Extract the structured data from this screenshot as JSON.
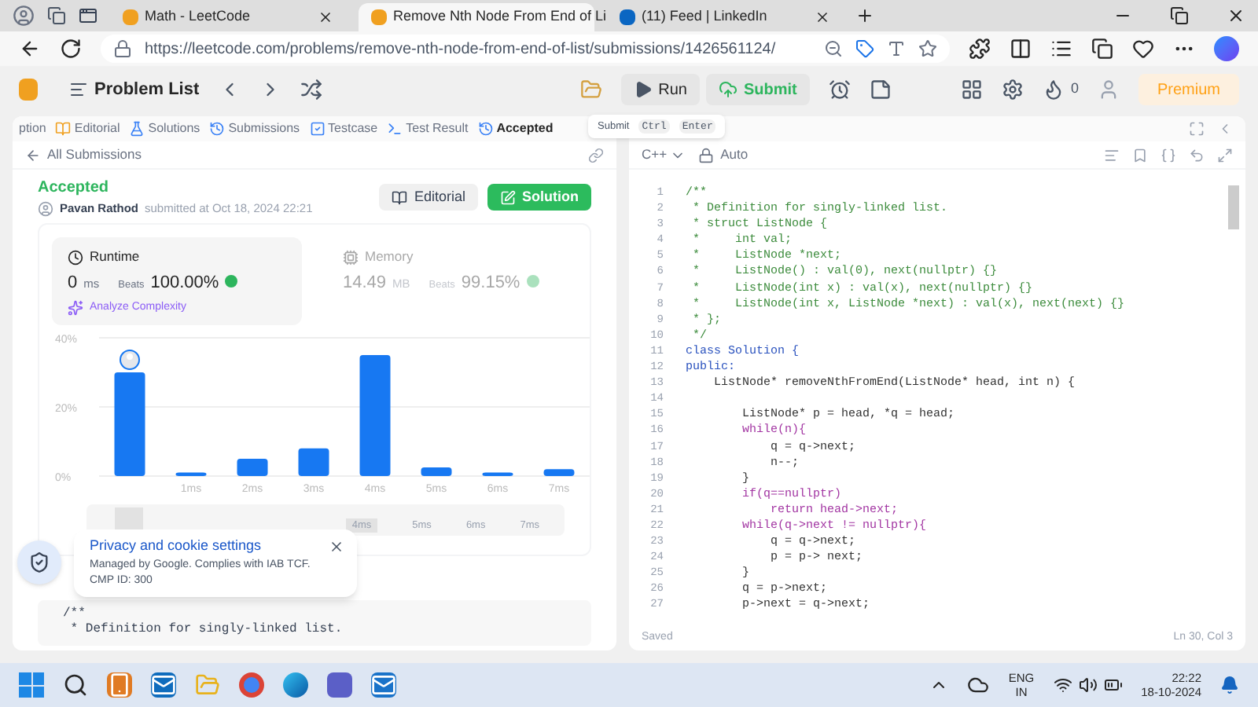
{
  "browser": {
    "tabs": [
      {
        "title": "Math - LeetCode",
        "selected": false
      },
      {
        "title": "Remove Nth Node From End of Li",
        "selected": true
      },
      {
        "title": "(11) Feed | LinkedIn",
        "selected": false
      }
    ],
    "url": "https://leetcode.com/problems/remove-nth-node-from-end-of-list/submissions/1426561124/"
  },
  "nav": {
    "title": "Problem List",
    "run": "Run",
    "submit": "Submit",
    "streak": "0",
    "premium": "Premium"
  },
  "tooltip": {
    "label": "Submit",
    "keys": [
      "Ctrl",
      "Enter"
    ]
  },
  "panel_tabs": [
    {
      "label": "ption",
      "selected": false
    },
    {
      "label": "Editorial",
      "selected": false
    },
    {
      "label": "Solutions",
      "selected": false
    },
    {
      "label": "Submissions",
      "selected": false
    },
    {
      "label": "Testcase",
      "selected": false
    },
    {
      "label": "Test Result",
      "selected": false
    },
    {
      "label": "Accepted",
      "selected": true
    }
  ],
  "submission": {
    "back": "All Submissions",
    "status": "Accepted",
    "author": "Pavan Rathod",
    "submitted": "submitted at Oct 18, 2024 22:21",
    "editorial": "Editorial",
    "solution": "Solution"
  },
  "stats": [
    {
      "label": "Runtime",
      "value": "0",
      "unit": "ms",
      "beats_label": "Beats",
      "beats": "100.00%",
      "analyze": "Analyze Complexity",
      "selected": true
    },
    {
      "label": "Memory",
      "value": "14.49",
      "unit": "MB",
      "beats_label": "Beats",
      "beats": "99.15%",
      "selected": false
    }
  ],
  "chart_data": {
    "type": "bar",
    "categories": [
      null,
      "1ms",
      "2ms",
      "3ms",
      "4ms",
      "5ms",
      "6ms",
      "7ms"
    ],
    "values": [
      30,
      1,
      5,
      8,
      35,
      2.5,
      1,
      2
    ],
    "ylim": [
      0,
      40
    ],
    "yticks": [
      {
        "value": 0,
        "label": "0%"
      },
      {
        "value": 20,
        "label": "20%"
      },
      {
        "value": 40,
        "label": "40%"
      }
    ]
  },
  "navigator": {
    "labels": [
      "4ms",
      "5ms",
      "6ms",
      "7ms"
    ]
  },
  "code_preview": [
    "/**",
    " * Definition for singly-linked list."
  ],
  "cookie_popup": {
    "title": "Privacy and cookie settings",
    "text": "Managed by Google. Complies with IAB TCF.",
    "cmp": "CMP ID: 300"
  },
  "editor": {
    "language": "C++",
    "mode": "Auto",
    "status": "Saved",
    "position": "Ln 30, Col 3",
    "lines": [
      {
        "n": "1",
        "text": "/**",
        "kind": "comment"
      },
      {
        "n": "2",
        "text": " * Definition for singly-linked list.",
        "kind": "comment"
      },
      {
        "n": "3",
        "text": " * struct ListNode {",
        "kind": "comment"
      },
      {
        "n": "4",
        "text": " *     int val;",
        "kind": "comment"
      },
      {
        "n": "5",
        "text": " *     ListNode *next;",
        "kind": "comment"
      },
      {
        "n": "6",
        "text": " *     ListNode() : val(0), next(nullptr) {}",
        "kind": "comment"
      },
      {
        "n": "7",
        "text": " *     ListNode(int x) : val(x), next(nullptr) {}",
        "kind": "comment"
      },
      {
        "n": "8",
        "text": " *     ListNode(int x, ListNode *next) : val(x), next(next) {}",
        "kind": "comment"
      },
      {
        "n": "9",
        "text": " * };",
        "kind": "comment"
      },
      {
        "n": "10",
        "text": " */",
        "kind": "comment"
      },
      {
        "n": "11",
        "text": "class Solution {",
        "kind": "keyword"
      },
      {
        "n": "12",
        "text": "public:",
        "kind": "keyword"
      },
      {
        "n": "13",
        "text": "    ListNode* removeNthFromEnd(ListNode* head, int n) {",
        "kind": "code"
      },
      {
        "n": "14"
      },
      {
        "n": "15",
        "text": "        ListNode* p = head, *q = head;",
        "kind": "code"
      },
      {
        "n": "16",
        "text": "        while(n){",
        "kind": "control"
      },
      {
        "n": "17",
        "text": "            q = q->next;",
        "kind": "code"
      },
      {
        "n": "18",
        "text": "            n--;",
        "kind": "code"
      },
      {
        "n": "19",
        "text": "        }",
        "kind": "code"
      },
      {
        "n": "20",
        "text": "        if(q==nullptr)",
        "kind": "control"
      },
      {
        "n": "21",
        "text": "            return head->next;",
        "kind": "control"
      },
      {
        "n": "22",
        "text": "        while(q->next != nullptr){",
        "kind": "control"
      },
      {
        "n": "23",
        "text": "            q = q->next;",
        "kind": "code"
      },
      {
        "n": "24",
        "text": "            p = p-> next;",
        "kind": "code"
      },
      {
        "n": "25",
        "text": "        }",
        "kind": "code"
      },
      {
        "n": "26",
        "text": "        q = p->next;",
        "kind": "code"
      },
      {
        "n": "27",
        "text": "        p->next = q->next;",
        "kind": "code"
      }
    ]
  },
  "taskbar": {
    "language": "ENG",
    "region": "IN",
    "time": "22:22",
    "date": "18-10-2024"
  }
}
